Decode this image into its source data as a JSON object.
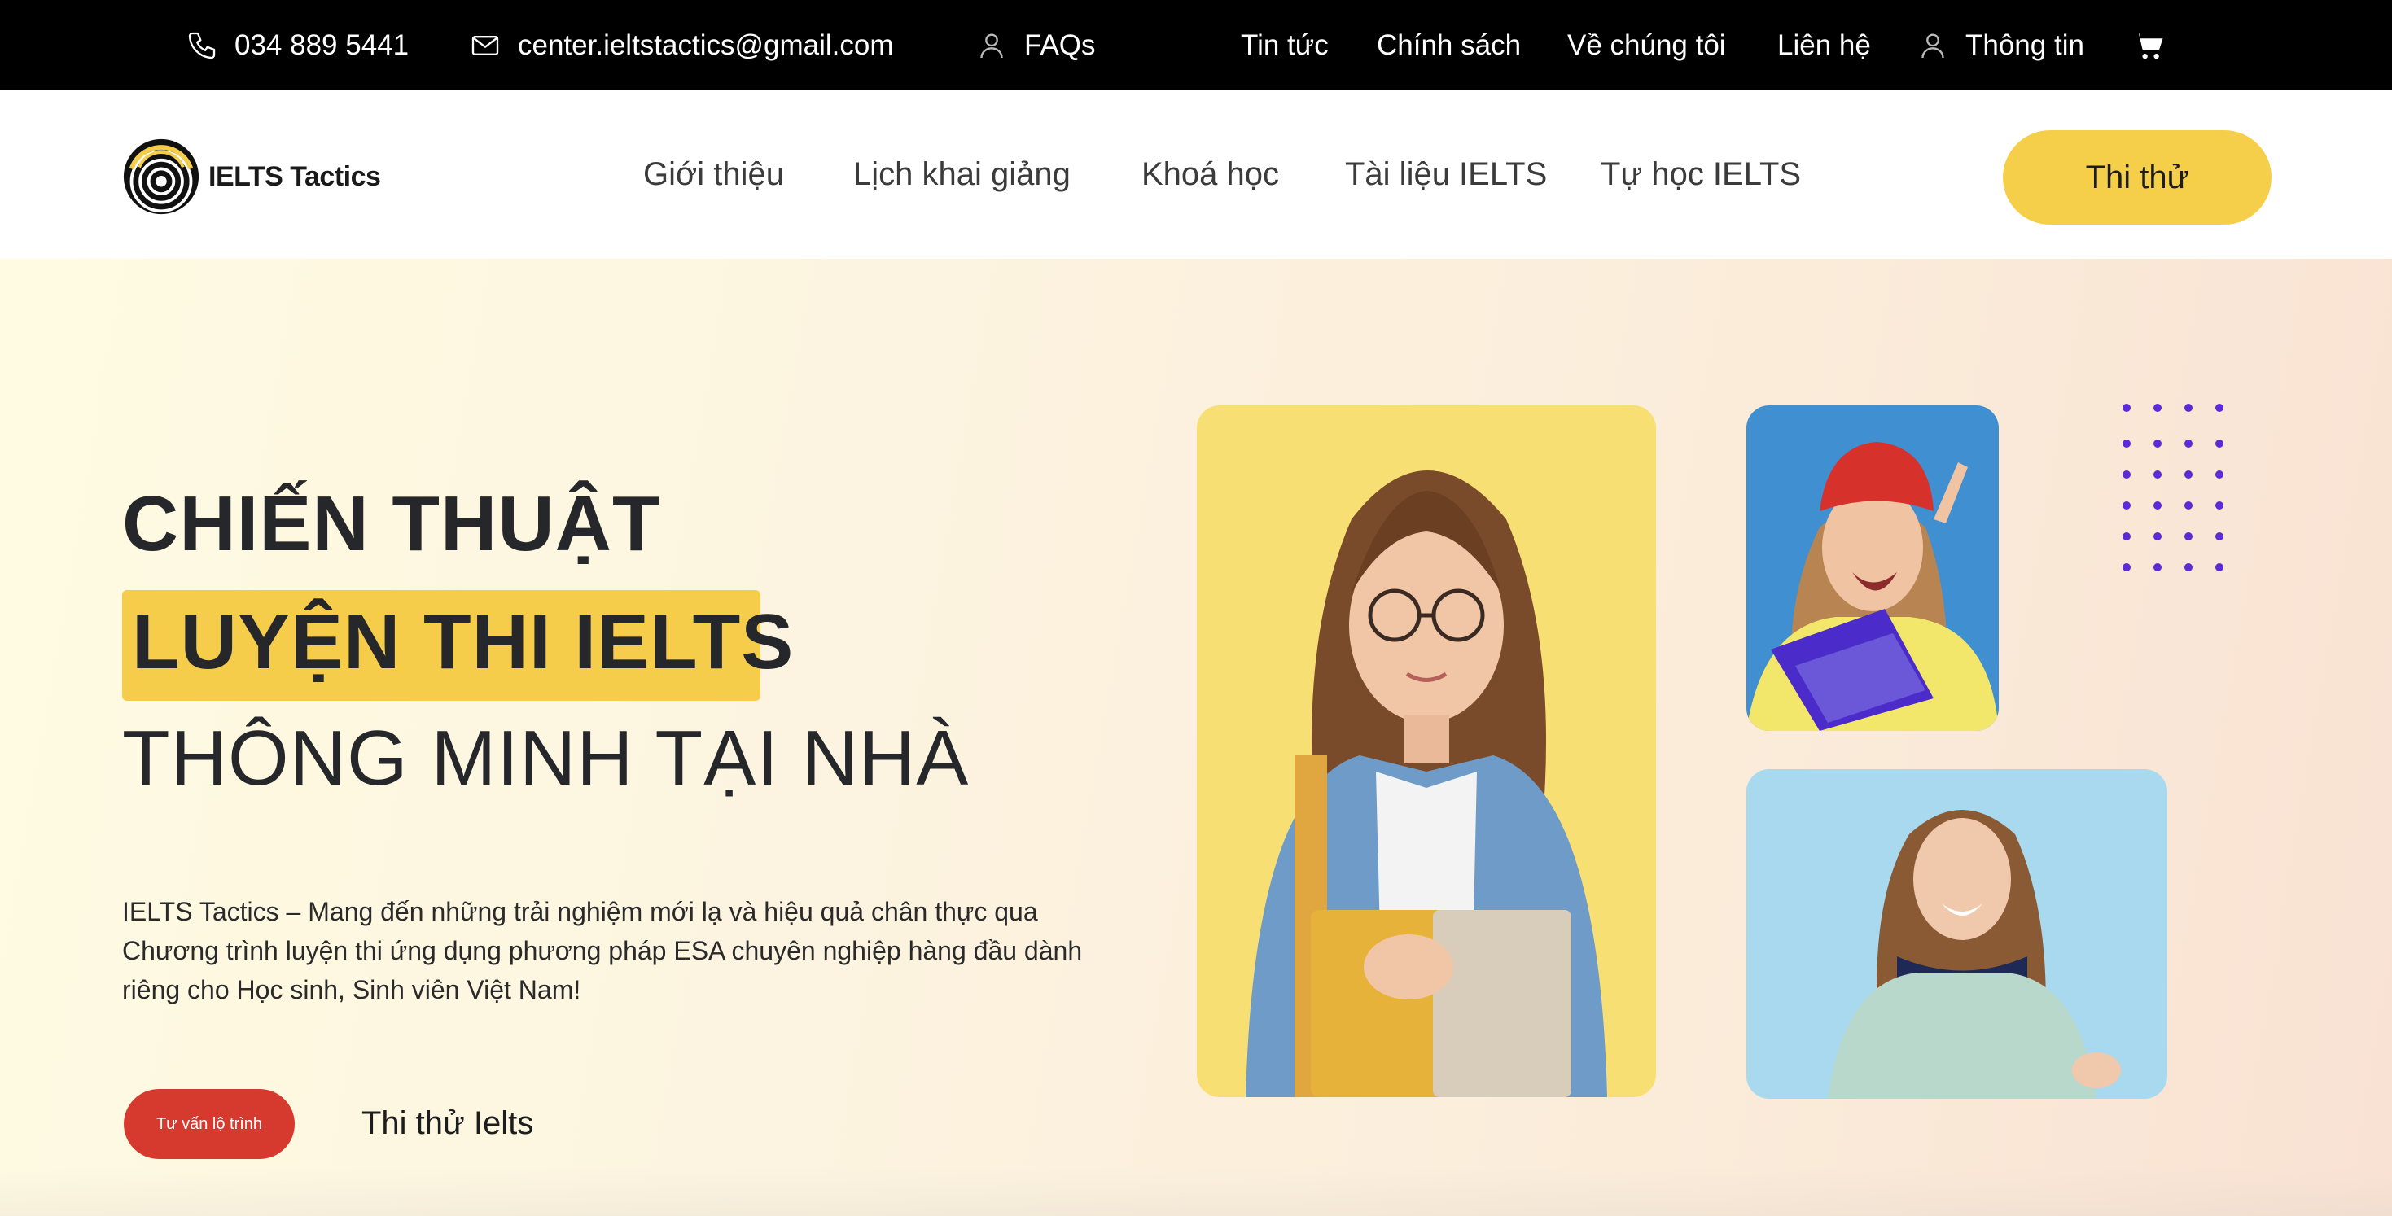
{
  "topbar": {
    "phone": "034 889 5441",
    "email": "center.ieltstactics@gmail.com",
    "faqs": "FAQs",
    "news": "Tin tức",
    "policy": "Chính sách",
    "about": "Về chúng tôi",
    "contact": "Liên hệ",
    "info": "Thông tin"
  },
  "nav": {
    "logo_text": "IELTS Tactics",
    "items": [
      "Giới thiệu",
      "Lịch khai giảng",
      "Khoá học",
      "Tài liệu IELTS",
      "Tự học IELTS"
    ],
    "cta": "Thi thử"
  },
  "hero": {
    "line1": "CHIẾN THUẬT",
    "line2": "LUYỆN THI IELTS",
    "line3": "THÔNG MINH TẠI NHÀ",
    "description": "IELTS Tactics – Mang đến những trải nghiệm mới lạ và hiệu quả chân thực qua Chương trình luyện thi ứng dụng phương pháp ESA chuyên nghiệp hàng đầu dành riêng cho Học sinh, Sinh viên Việt Nam!",
    "consult_button": "Tư vấn lộ trình",
    "test_link": "Thi thử Ielts"
  },
  "colors": {
    "topbar_bg": "#000000",
    "accent_yellow": "#f5cd4b",
    "button_red": "#d63a2f",
    "dot_purple": "#5b2bd9"
  },
  "icons": [
    "phone-icon",
    "mail-icon",
    "user-icon",
    "user-icon",
    "cart-icon"
  ]
}
